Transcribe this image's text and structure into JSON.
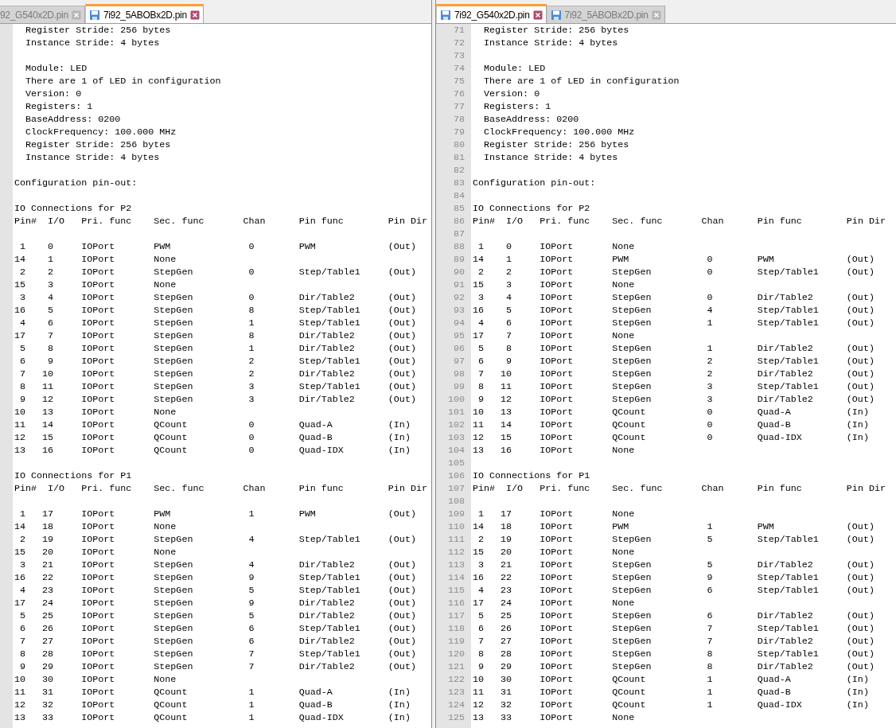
{
  "panes": [
    {
      "tabs": [
        {
          "label": "92_G540x2D.pin",
          "selected": false,
          "cut": true
        },
        {
          "label": "7i92_5ABOBx2D.pin",
          "selected": true,
          "cut": false
        }
      ],
      "lines": [
        {
          "kind": "detail",
          "text": "Register Stride: 256 bytes"
        },
        {
          "kind": "detail",
          "text": "Instance Stride: 4 bytes"
        },
        {
          "kind": "blank"
        },
        {
          "kind": "detail",
          "text": "Module: LED"
        },
        {
          "kind": "detail",
          "text": "There are 1 of LED in configuration"
        },
        {
          "kind": "detail",
          "text": "Version: 0"
        },
        {
          "kind": "detail",
          "text": "Registers: 1"
        },
        {
          "kind": "detail",
          "text": "BaseAddress: 0200"
        },
        {
          "kind": "detail",
          "text": "ClockFrequency: 100.000 MHz"
        },
        {
          "kind": "detail",
          "text": "Register Stride: 256 bytes"
        },
        {
          "kind": "detail",
          "text": "Instance Stride: 4 bytes"
        },
        {
          "kind": "blank"
        },
        {
          "kind": "text",
          "text": "Configuration pin-out:"
        },
        {
          "kind": "blank"
        },
        {
          "kind": "text",
          "text": "IO Connections for P2"
        },
        {
          "kind": "header",
          "cells": [
            "Pin#",
            "I/O",
            "Pri. func",
            "Sec. func",
            "Chan",
            "Pin func",
            "Pin Dir"
          ]
        },
        {
          "kind": "blank"
        },
        {
          "kind": "row",
          "cells": [
            "1",
            "0",
            "IOPort",
            "PWM",
            "0",
            "PWM",
            "(Out)"
          ]
        },
        {
          "kind": "row",
          "cells": [
            "14",
            "1",
            "IOPort",
            "None"
          ]
        },
        {
          "kind": "row",
          "cells": [
            "2",
            "2",
            "IOPort",
            "StepGen",
            "0",
            "Step/Table1",
            "(Out)"
          ]
        },
        {
          "kind": "row",
          "cells": [
            "15",
            "3",
            "IOPort",
            "None"
          ]
        },
        {
          "kind": "row",
          "cells": [
            "3",
            "4",
            "IOPort",
            "StepGen",
            "0",
            "Dir/Table2",
            "(Out)"
          ]
        },
        {
          "kind": "row",
          "cells": [
            "16",
            "5",
            "IOPort",
            "StepGen",
            "8",
            "Step/Table1",
            "(Out)"
          ]
        },
        {
          "kind": "row",
          "cells": [
            "4",
            "6",
            "IOPort",
            "StepGen",
            "1",
            "Step/Table1",
            "(Out)"
          ]
        },
        {
          "kind": "row",
          "cells": [
            "17",
            "7",
            "IOPort",
            "StepGen",
            "8",
            "Dir/Table2",
            "(Out)"
          ]
        },
        {
          "kind": "row",
          "cells": [
            "5",
            "8",
            "IOPort",
            "StepGen",
            "1",
            "Dir/Table2",
            "(Out)"
          ]
        },
        {
          "kind": "row",
          "cells": [
            "6",
            "9",
            "IOPort",
            "StepGen",
            "2",
            "Step/Table1",
            "(Out)"
          ]
        },
        {
          "kind": "row",
          "cells": [
            "7",
            "10",
            "IOPort",
            "StepGen",
            "2",
            "Dir/Table2",
            "(Out)"
          ]
        },
        {
          "kind": "row",
          "cells": [
            "8",
            "11",
            "IOPort",
            "StepGen",
            "3",
            "Step/Table1",
            "(Out)"
          ]
        },
        {
          "kind": "row",
          "cells": [
            "9",
            "12",
            "IOPort",
            "StepGen",
            "3",
            "Dir/Table2",
            "(Out)"
          ]
        },
        {
          "kind": "row",
          "cells": [
            "10",
            "13",
            "IOPort",
            "None"
          ]
        },
        {
          "kind": "row",
          "cells": [
            "11",
            "14",
            "IOPort",
            "QCount",
            "0",
            "Quad-A",
            "(In)"
          ]
        },
        {
          "kind": "row",
          "cells": [
            "12",
            "15",
            "IOPort",
            "QCount",
            "0",
            "Quad-B",
            "(In)"
          ]
        },
        {
          "kind": "row",
          "cells": [
            "13",
            "16",
            "IOPort",
            "QCount",
            "0",
            "Quad-IDX",
            "(In)"
          ]
        },
        {
          "kind": "blank"
        },
        {
          "kind": "text",
          "text": "IO Connections for P1"
        },
        {
          "kind": "header",
          "cells": [
            "Pin#",
            "I/O",
            "Pri. func",
            "Sec. func",
            "Chan",
            "Pin func",
            "Pin Dir"
          ]
        },
        {
          "kind": "blank"
        },
        {
          "kind": "row",
          "cells": [
            "1",
            "17",
            "IOPort",
            "PWM",
            "1",
            "PWM",
            "(Out)"
          ]
        },
        {
          "kind": "row",
          "cells": [
            "14",
            "18",
            "IOPort",
            "None"
          ]
        },
        {
          "kind": "row",
          "cells": [
            "2",
            "19",
            "IOPort",
            "StepGen",
            "4",
            "Step/Table1",
            "(Out)"
          ]
        },
        {
          "kind": "row",
          "cells": [
            "15",
            "20",
            "IOPort",
            "None"
          ]
        },
        {
          "kind": "row",
          "cells": [
            "3",
            "21",
            "IOPort",
            "StepGen",
            "4",
            "Dir/Table2",
            "(Out)"
          ]
        },
        {
          "kind": "row",
          "cells": [
            "16",
            "22",
            "IOPort",
            "StepGen",
            "9",
            "Step/Table1",
            "(Out)"
          ]
        },
        {
          "kind": "row",
          "cells": [
            "4",
            "23",
            "IOPort",
            "StepGen",
            "5",
            "Step/Table1",
            "(Out)"
          ]
        },
        {
          "kind": "row",
          "cells": [
            "17",
            "24",
            "IOPort",
            "StepGen",
            "9",
            "Dir/Table2",
            "(Out)"
          ]
        },
        {
          "kind": "row",
          "cells": [
            "5",
            "25",
            "IOPort",
            "StepGen",
            "5",
            "Dir/Table2",
            "(Out)"
          ]
        },
        {
          "kind": "row",
          "cells": [
            "6",
            "26",
            "IOPort",
            "StepGen",
            "6",
            "Step/Table1",
            "(Out)"
          ]
        },
        {
          "kind": "row",
          "cells": [
            "7",
            "27",
            "IOPort",
            "StepGen",
            "6",
            "Dir/Table2",
            "(Out)"
          ]
        },
        {
          "kind": "row",
          "cells": [
            "8",
            "28",
            "IOPort",
            "StepGen",
            "7",
            "Step/Table1",
            "(Out)"
          ]
        },
        {
          "kind": "row",
          "cells": [
            "9",
            "29",
            "IOPort",
            "StepGen",
            "7",
            "Dir/Table2",
            "(Out)"
          ]
        },
        {
          "kind": "row",
          "cells": [
            "10",
            "30",
            "IOPort",
            "None"
          ]
        },
        {
          "kind": "row",
          "cells": [
            "11",
            "31",
            "IOPort",
            "QCount",
            "1",
            "Quad-A",
            "(In)"
          ]
        },
        {
          "kind": "row",
          "cells": [
            "12",
            "32",
            "IOPort",
            "QCount",
            "1",
            "Quad-B",
            "(In)"
          ]
        },
        {
          "kind": "row",
          "cells": [
            "13",
            "33",
            "IOPort",
            "QCount",
            "1",
            "Quad-IDX",
            "(In)"
          ]
        }
      ]
    },
    {
      "tabs": [
        {
          "label": "7i92_G540x2D.pin",
          "selected": true,
          "cut": false
        },
        {
          "label": "7i92_5ABOBx2D.pin",
          "selected": false,
          "cut": false
        }
      ],
      "lines": [
        {
          "line_number": "71",
          "kind": "detail",
          "text": "Register Stride: 256 bytes"
        },
        {
          "line_number": "72",
          "kind": "detail",
          "text": "Instance Stride: 4 bytes"
        },
        {
          "line_number": "73",
          "kind": "blank"
        },
        {
          "line_number": "74",
          "kind": "detail",
          "text": "Module: LED"
        },
        {
          "line_number": "75",
          "kind": "detail",
          "text": "There are 1 of LED in configuration"
        },
        {
          "line_number": "76",
          "kind": "detail",
          "text": "Version: 0"
        },
        {
          "line_number": "77",
          "kind": "detail",
          "text": "Registers: 1"
        },
        {
          "line_number": "78",
          "kind": "detail",
          "text": "BaseAddress: 0200"
        },
        {
          "line_number": "79",
          "kind": "detail",
          "text": "ClockFrequency: 100.000 MHz"
        },
        {
          "line_number": "80",
          "kind": "detail",
          "text": "Register Stride: 256 bytes"
        },
        {
          "line_number": "81",
          "kind": "detail",
          "text": "Instance Stride: 4 bytes"
        },
        {
          "line_number": "82",
          "kind": "blank"
        },
        {
          "line_number": "83",
          "kind": "text",
          "text": "Configuration pin-out:"
        },
        {
          "line_number": "84",
          "kind": "blank"
        },
        {
          "line_number": "85",
          "kind": "text",
          "text": "IO Connections for P2"
        },
        {
          "line_number": "86",
          "kind": "header",
          "cells": [
            "Pin#",
            "I/O",
            "Pri. func",
            "Sec. func",
            "Chan",
            "Pin func",
            "Pin Dir"
          ]
        },
        {
          "line_number": "87",
          "kind": "blank"
        },
        {
          "line_number": "88",
          "kind": "row",
          "cells": [
            "1",
            "0",
            "IOPort",
            "None"
          ]
        },
        {
          "line_number": "89",
          "kind": "row",
          "cells": [
            "14",
            "1",
            "IOPort",
            "PWM",
            "0",
            "PWM",
            "(Out)"
          ]
        },
        {
          "line_number": "90",
          "kind": "row",
          "cells": [
            "2",
            "2",
            "IOPort",
            "StepGen",
            "0",
            "Step/Table1",
            "(Out)"
          ]
        },
        {
          "line_number": "91",
          "kind": "row",
          "cells": [
            "15",
            "3",
            "IOPort",
            "None"
          ]
        },
        {
          "line_number": "92",
          "kind": "row",
          "cells": [
            "3",
            "4",
            "IOPort",
            "StepGen",
            "0",
            "Dir/Table2",
            "(Out)"
          ]
        },
        {
          "line_number": "93",
          "kind": "row",
          "cells": [
            "16",
            "5",
            "IOPort",
            "StepGen",
            "4",
            "Step/Table1",
            "(Out)"
          ]
        },
        {
          "line_number": "94",
          "kind": "row",
          "cells": [
            "4",
            "6",
            "IOPort",
            "StepGen",
            "1",
            "Step/Table1",
            "(Out)"
          ]
        },
        {
          "line_number": "95",
          "kind": "row",
          "cells": [
            "17",
            "7",
            "IOPort",
            "None"
          ]
        },
        {
          "line_number": "96",
          "kind": "row",
          "cells": [
            "5",
            "8",
            "IOPort",
            "StepGen",
            "1",
            "Dir/Table2",
            "(Out)"
          ]
        },
        {
          "line_number": "97",
          "kind": "row",
          "cells": [
            "6",
            "9",
            "IOPort",
            "StepGen",
            "2",
            "Step/Table1",
            "(Out)"
          ]
        },
        {
          "line_number": "98",
          "kind": "row",
          "cells": [
            "7",
            "10",
            "IOPort",
            "StepGen",
            "2",
            "Dir/Table2",
            "(Out)"
          ]
        },
        {
          "line_number": "99",
          "kind": "row",
          "cells": [
            "8",
            "11",
            "IOPort",
            "StepGen",
            "3",
            "Step/Table1",
            "(Out)"
          ]
        },
        {
          "line_number": "100",
          "kind": "row",
          "cells": [
            "9",
            "12",
            "IOPort",
            "StepGen",
            "3",
            "Dir/Table2",
            "(Out)"
          ]
        },
        {
          "line_number": "101",
          "kind": "row",
          "cells": [
            "10",
            "13",
            "IOPort",
            "QCount",
            "0",
            "Quad-A",
            "(In)"
          ]
        },
        {
          "line_number": "102",
          "kind": "row",
          "cells": [
            "11",
            "14",
            "IOPort",
            "QCount",
            "0",
            "Quad-B",
            "(In)"
          ]
        },
        {
          "line_number": "103",
          "kind": "row",
          "cells": [
            "12",
            "15",
            "IOPort",
            "QCount",
            "0",
            "Quad-IDX",
            "(In)"
          ]
        },
        {
          "line_number": "104",
          "kind": "row",
          "cells": [
            "13",
            "16",
            "IOPort",
            "None"
          ]
        },
        {
          "line_number": "105",
          "kind": "blank"
        },
        {
          "line_number": "106",
          "kind": "text",
          "text": "IO Connections for P1"
        },
        {
          "line_number": "107",
          "kind": "header",
          "cells": [
            "Pin#",
            "I/O",
            "Pri. func",
            "Sec. func",
            "Chan",
            "Pin func",
            "Pin Dir"
          ]
        },
        {
          "line_number": "108",
          "kind": "blank"
        },
        {
          "line_number": "109",
          "kind": "row",
          "cells": [
            "1",
            "17",
            "IOPort",
            "None"
          ]
        },
        {
          "line_number": "110",
          "kind": "row",
          "cells": [
            "14",
            "18",
            "IOPort",
            "PWM",
            "1",
            "PWM",
            "(Out)"
          ]
        },
        {
          "line_number": "111",
          "kind": "row",
          "cells": [
            "2",
            "19",
            "IOPort",
            "StepGen",
            "5",
            "Step/Table1",
            "(Out)"
          ]
        },
        {
          "line_number": "112",
          "kind": "row",
          "cells": [
            "15",
            "20",
            "IOPort",
            "None"
          ]
        },
        {
          "line_number": "113",
          "kind": "row",
          "cells": [
            "3",
            "21",
            "IOPort",
            "StepGen",
            "5",
            "Dir/Table2",
            "(Out)"
          ]
        },
        {
          "line_number": "114",
          "kind": "row",
          "cells": [
            "16",
            "22",
            "IOPort",
            "StepGen",
            "9",
            "Step/Table1",
            "(Out)"
          ]
        },
        {
          "line_number": "115",
          "kind": "row",
          "cells": [
            "4",
            "23",
            "IOPort",
            "StepGen",
            "6",
            "Step/Table1",
            "(Out)"
          ]
        },
        {
          "line_number": "116",
          "kind": "row",
          "cells": [
            "17",
            "24",
            "IOPort",
            "None"
          ]
        },
        {
          "line_number": "117",
          "kind": "row",
          "cells": [
            "5",
            "25",
            "IOPort",
            "StepGen",
            "6",
            "Dir/Table2",
            "(Out)"
          ]
        },
        {
          "line_number": "118",
          "kind": "row",
          "cells": [
            "6",
            "26",
            "IOPort",
            "StepGen",
            "7",
            "Step/Table1",
            "(Out)"
          ]
        },
        {
          "line_number": "119",
          "kind": "row",
          "cells": [
            "7",
            "27",
            "IOPort",
            "StepGen",
            "7",
            "Dir/Table2",
            "(Out)"
          ]
        },
        {
          "line_number": "120",
          "kind": "row",
          "cells": [
            "8",
            "28",
            "IOPort",
            "StepGen",
            "8",
            "Step/Table1",
            "(Out)"
          ]
        },
        {
          "line_number": "121",
          "kind": "row",
          "cells": [
            "9",
            "29",
            "IOPort",
            "StepGen",
            "8",
            "Dir/Table2",
            "(Out)"
          ]
        },
        {
          "line_number": "122",
          "kind": "row",
          "cells": [
            "10",
            "30",
            "IOPort",
            "QCount",
            "1",
            "Quad-A",
            "(In)"
          ]
        },
        {
          "line_number": "123",
          "kind": "row",
          "cells": [
            "11",
            "31",
            "IOPort",
            "QCount",
            "1",
            "Quad-B",
            "(In)"
          ]
        },
        {
          "line_number": "124",
          "kind": "row",
          "cells": [
            "12",
            "32",
            "IOPort",
            "QCount",
            "1",
            "Quad-IDX",
            "(In)"
          ]
        },
        {
          "line_number": "125",
          "kind": "row",
          "cells": [
            "13",
            "33",
            "IOPort",
            "None"
          ]
        }
      ]
    }
  ]
}
